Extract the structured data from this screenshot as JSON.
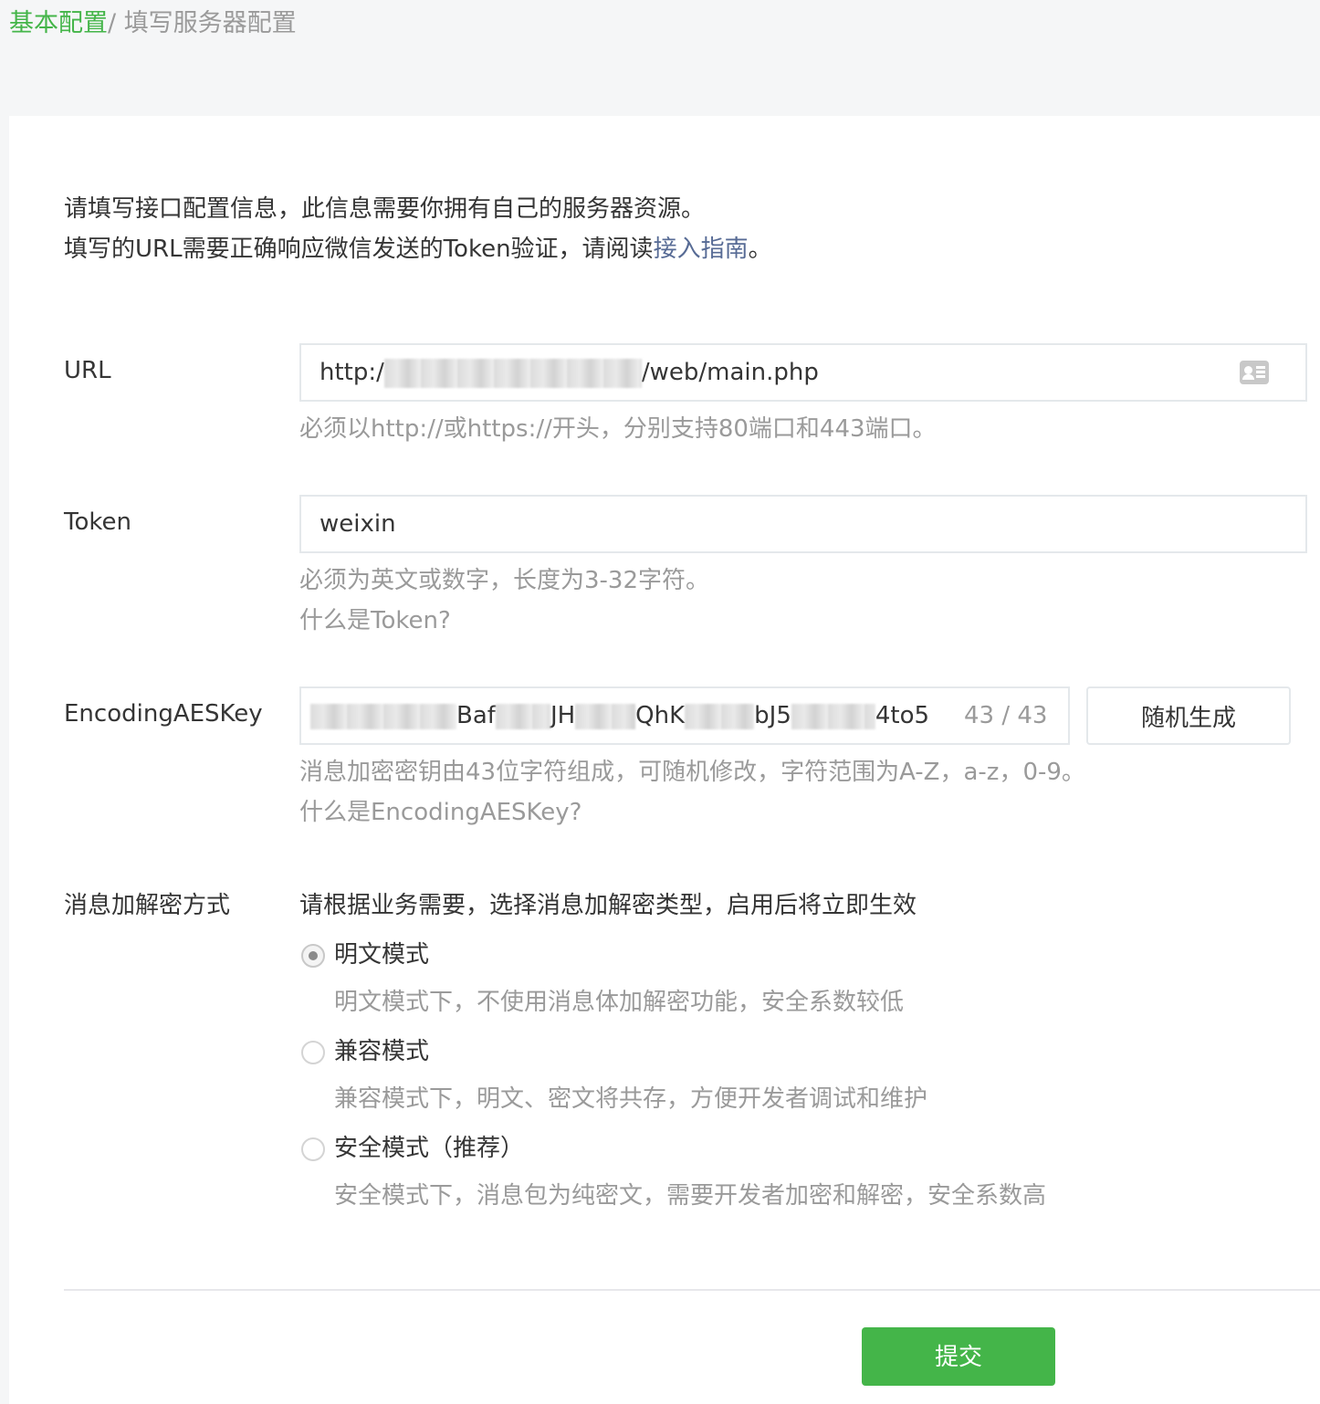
{
  "breadcrumb": {
    "parent": "基本配置",
    "separator": "/ ",
    "current": "填写服务器配置"
  },
  "intro": {
    "line1": "请填写接口配置信息，此信息需要你拥有自己的服务器资源。",
    "line2_prefix": "填写的URL需要正确响应微信发送的Token验证，请阅读",
    "line2_link": "接入指南",
    "line2_suffix": "。"
  },
  "url": {
    "label": "URL",
    "value_prefix": "http:/",
    "value_suffix": "/web/main.php",
    "icon": "contact-card-icon",
    "hint": "必须以http://或https://开头，分别支持80端口和443端口。"
  },
  "token": {
    "label": "Token",
    "value": "weixin",
    "hint": "必须为英文或数字，长度为3-32字符。",
    "help_link": "什么是Token?"
  },
  "aeskey": {
    "label": "EncodingAESKey",
    "visible_fragments": [
      "Baf",
      "JH",
      "QhK",
      "bJ5",
      "4to5"
    ],
    "counter": "43 / 43",
    "generate_button": "随机生成",
    "hint": "消息加密密钥由43位字符组成，可随机修改，字符范围为A-Z，a-z，0-9。",
    "help_link": "什么是EncodingAESKey?"
  },
  "encryption": {
    "label": "消息加解密方式",
    "description": "请根据业务需要，选择消息加解密类型，启用后将立即生效",
    "selected": "plaintext",
    "options": [
      {
        "id": "plaintext",
        "label": "明文模式",
        "desc": "明文模式下，不使用消息体加解密功能，安全系数较低"
      },
      {
        "id": "compatible",
        "label": "兼容模式",
        "desc": "兼容模式下，明文、密文将共存，方便开发者调试和维护"
      },
      {
        "id": "secure",
        "label": "安全模式（推荐）",
        "desc": "安全模式下，消息包为纯密文，需要开发者加密和解密，安全系数高"
      }
    ]
  },
  "submit_button": "提交",
  "colors": {
    "brand_green": "#44b549",
    "link_blue": "#576b95",
    "hint_gray": "#9a9a9a",
    "page_bg": "#f5f6f7"
  }
}
